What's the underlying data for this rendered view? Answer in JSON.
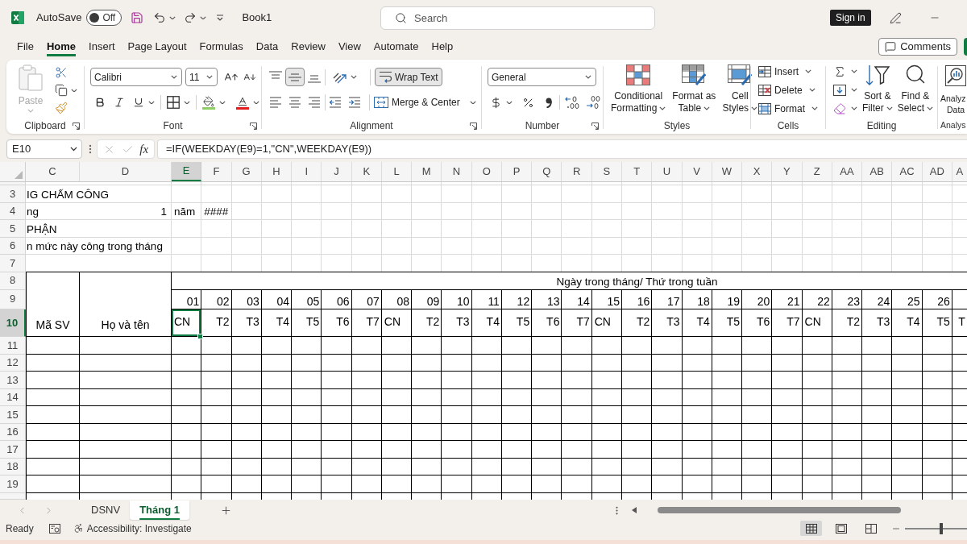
{
  "title_bar": {
    "autosave": {
      "label": "AutoSave",
      "on": false,
      "state_text": "Off"
    },
    "document_title": "Book1",
    "search": {
      "placeholder": "Search"
    },
    "sign_in": "Sign in"
  },
  "menu_tabs": [
    {
      "label": "File",
      "selected": false
    },
    {
      "label": "Home",
      "selected": true
    },
    {
      "label": "Insert",
      "selected": false
    },
    {
      "label": "Page Layout",
      "selected": false
    },
    {
      "label": "Formulas",
      "selected": false
    },
    {
      "label": "Data",
      "selected": false
    },
    {
      "label": "Review",
      "selected": false
    },
    {
      "label": "View",
      "selected": false
    },
    {
      "label": "Automate",
      "selected": false
    },
    {
      "label": "Help",
      "selected": false
    }
  ],
  "comments_button": "Comments",
  "ribbon": {
    "groups": [
      {
        "kind": "clipboard",
        "label": "Clipboard",
        "paste": {
          "label": "Paste",
          "disabled": true
        }
      },
      {
        "kind": "font",
        "label": "Font",
        "font_name": "Calibri",
        "font_size": "11"
      },
      {
        "kind": "alignment",
        "label": "Alignment",
        "vertical_align": [
          {
            "kind": "top",
            "selected": false
          },
          {
            "kind": "middle",
            "selected": true
          },
          {
            "kind": "bottom",
            "selected": false
          }
        ],
        "wrap_text": {
          "label": "Wrap Text",
          "selected": true
        },
        "merge": "Merge & Center"
      },
      {
        "kind": "number",
        "label": "Number",
        "format": "General"
      },
      {
        "kind": "styles",
        "label": "Styles",
        "buttons": [
          {
            "lines": [
              "Conditional",
              "Formatting"
            ]
          },
          {
            "lines": [
              "Format as",
              "Table"
            ]
          },
          {
            "lines": [
              "Cell",
              "Styles"
            ]
          }
        ]
      },
      {
        "kind": "cells",
        "label": "Cells",
        "buttons": [
          "Insert",
          "Delete",
          "Format"
        ]
      },
      {
        "kind": "editing",
        "label": "Editing",
        "buttons": [
          {
            "lines": [
              "Sort &",
              "Filter"
            ]
          },
          {
            "lines": [
              "Find &",
              "Select"
            ]
          }
        ]
      },
      {
        "kind": "analysis",
        "label": "Analys",
        "button_lines": [
          "Analyz",
          "Data"
        ]
      }
    ]
  },
  "formula_bar": {
    "name_box": "E10",
    "function_button": "fx",
    "formula": "=IF(WEEKDAY(E9)=1,\"CN\",WEEKDAY(E9))"
  },
  "sheet": {
    "column_headers": [
      {
        "label": "C",
        "selected": false
      },
      {
        "label": "D",
        "selected": false
      },
      {
        "label": "E",
        "selected": true
      },
      {
        "label": "F",
        "selected": false
      },
      {
        "label": "G",
        "selected": false
      },
      {
        "label": "H",
        "selected": false
      },
      {
        "label": "I",
        "selected": false
      },
      {
        "label": "J",
        "selected": false
      },
      {
        "label": "K",
        "selected": false
      },
      {
        "label": "L",
        "selected": false
      },
      {
        "label": "M",
        "selected": false
      },
      {
        "label": "N",
        "selected": false
      },
      {
        "label": "O",
        "selected": false
      },
      {
        "label": "P",
        "selected": false
      },
      {
        "label": "Q",
        "selected": false
      },
      {
        "label": "R",
        "selected": false
      },
      {
        "label": "S",
        "selected": false
      },
      {
        "label": "T",
        "selected": false
      },
      {
        "label": "U",
        "selected": false
      },
      {
        "label": "V",
        "selected": false
      },
      {
        "label": "W",
        "selected": false
      },
      {
        "label": "X",
        "selected": false
      },
      {
        "label": "Y",
        "selected": false
      },
      {
        "label": "Z",
        "selected": false
      },
      {
        "label": "AA",
        "selected": false
      },
      {
        "label": "AB",
        "selected": false
      },
      {
        "label": "AC",
        "selected": false
      },
      {
        "label": "AD",
        "selected": false
      },
      {
        "label": "A",
        "selected": false
      }
    ],
    "row_headers": [
      {
        "label": "3",
        "selected": false
      },
      {
        "label": "4",
        "selected": false
      },
      {
        "label": "5",
        "selected": false
      },
      {
        "label": "6",
        "selected": false
      },
      {
        "label": "7",
        "selected": false
      },
      {
        "label": "8",
        "selected": false
      },
      {
        "label": "9",
        "selected": false
      },
      {
        "label": "10",
        "selected": true
      },
      {
        "label": "11",
        "selected": false
      },
      {
        "label": "12",
        "selected": false
      },
      {
        "label": "13",
        "selected": false
      },
      {
        "label": "14",
        "selected": false
      },
      {
        "label": "15",
        "selected": false
      },
      {
        "label": "16",
        "selected": false
      },
      {
        "label": "17",
        "selected": false
      },
      {
        "label": "18",
        "selected": false
      },
      {
        "label": "19",
        "selected": false
      }
    ],
    "heading": {
      "title": "IG CHẤM CÔNG",
      "month_label": "ng",
      "month_value": "1",
      "year_label": "năm",
      "year_value": "####",
      "department": "PHẬN",
      "note": "n mức này công trong tháng"
    },
    "table": {
      "id_header": "Mã SV",
      "name_header": "Họ và tên",
      "days_header": "Ngày trong tháng/ Thứ trong tuần",
      "days": [
        {
          "number": "01",
          "weekday": "CN",
          "kind": "text",
          "selected": true
        },
        {
          "number": "02",
          "weekday": "T2",
          "kind": "number",
          "selected": false
        },
        {
          "number": "03",
          "weekday": "T3",
          "kind": "number",
          "selected": false
        },
        {
          "number": "04",
          "weekday": "T4",
          "kind": "number",
          "selected": false
        },
        {
          "number": "05",
          "weekday": "T5",
          "kind": "number",
          "selected": false
        },
        {
          "number": "06",
          "weekday": "T6",
          "kind": "number",
          "selected": false
        },
        {
          "number": "07",
          "weekday": "T7",
          "kind": "number",
          "selected": false
        },
        {
          "number": "08",
          "weekday": "CN",
          "kind": "text",
          "selected": false
        },
        {
          "number": "09",
          "weekday": "T2",
          "kind": "number",
          "selected": false
        },
        {
          "number": "10",
          "weekday": "T3",
          "kind": "number",
          "selected": false
        },
        {
          "number": "11",
          "weekday": "T4",
          "kind": "number",
          "selected": false
        },
        {
          "number": "12",
          "weekday": "T5",
          "kind": "number",
          "selected": false
        },
        {
          "number": "13",
          "weekday": "T6",
          "kind": "number",
          "selected": false
        },
        {
          "number": "14",
          "weekday": "T7",
          "kind": "number",
          "selected": false
        },
        {
          "number": "15",
          "weekday": "CN",
          "kind": "text",
          "selected": false
        },
        {
          "number": "16",
          "weekday": "T2",
          "kind": "number",
          "selected": false
        },
        {
          "number": "17",
          "weekday": "T3",
          "kind": "number",
          "selected": false
        },
        {
          "number": "18",
          "weekday": "T4",
          "kind": "number",
          "selected": false
        },
        {
          "number": "19",
          "weekday": "T5",
          "kind": "number",
          "selected": false
        },
        {
          "number": "20",
          "weekday": "T6",
          "kind": "number",
          "selected": false
        },
        {
          "number": "21",
          "weekday": "T7",
          "kind": "number",
          "selected": false
        },
        {
          "number": "22",
          "weekday": "CN",
          "kind": "text",
          "selected": false
        },
        {
          "number": "23",
          "weekday": "T2",
          "kind": "number",
          "selected": false
        },
        {
          "number": "24",
          "weekday": "T3",
          "kind": "number",
          "selected": false
        },
        {
          "number": "25",
          "weekday": "T4",
          "kind": "number",
          "selected": false
        },
        {
          "number": "26",
          "weekday": "T5",
          "kind": "number",
          "selected": false
        },
        {
          "weekday": "T",
          "kind": "number",
          "selected": false
        }
      ]
    }
  },
  "sheet_tabs": [
    {
      "label": "DSNV",
      "selected": false
    },
    {
      "label": "Tháng 1",
      "selected": true
    }
  ],
  "status_bar": {
    "status": "Ready",
    "accessibility": "Accessibility: Investigate",
    "view_buttons": [
      {
        "kind": "normal",
        "selected": true
      },
      {
        "kind": "page_layout",
        "selected": false
      },
      {
        "kind": "page_break_preview",
        "selected": false
      }
    ],
    "zoom_slider": {
      "level": 0.58
    }
  }
}
